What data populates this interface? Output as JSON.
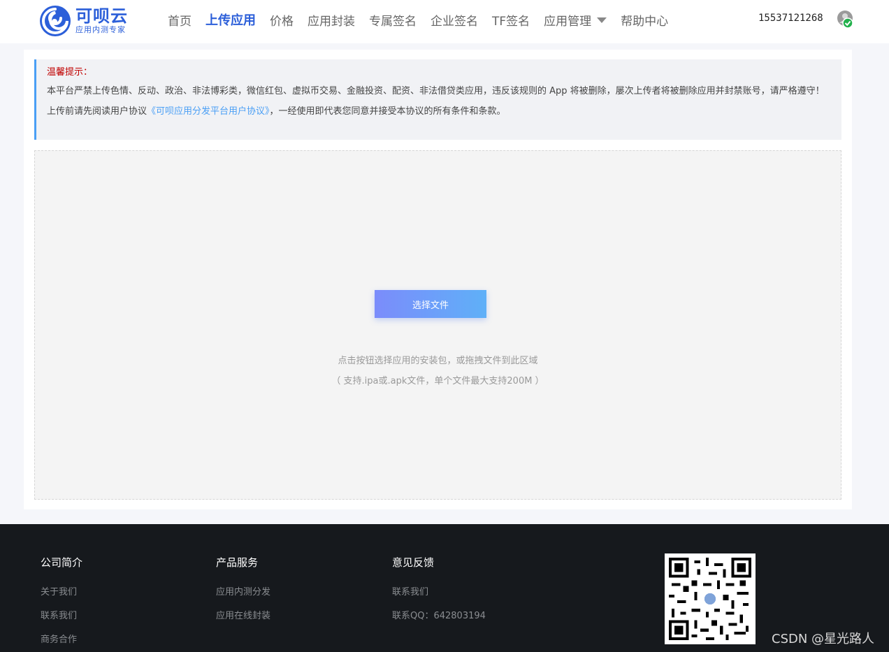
{
  "header": {
    "logo_title": "可呗云",
    "logo_sub": "应用内测专家",
    "nav": [
      {
        "label": "首页",
        "active": false
      },
      {
        "label": "上传应用",
        "active": true
      },
      {
        "label": "价格",
        "active": false
      },
      {
        "label": "应用封装",
        "active": false
      },
      {
        "label": "专属签名",
        "active": false
      },
      {
        "label": "企业签名",
        "active": false
      },
      {
        "label": "TF签名",
        "active": false
      },
      {
        "label": "应用管理",
        "active": false,
        "dropdown": true
      },
      {
        "label": "帮助中心",
        "active": false
      }
    ],
    "phone": "15537121268",
    "user_icon": "user-verified-icon"
  },
  "notice": {
    "title": "温馨提示：",
    "body": "本平台严禁上传色情、反动、政治、非法博彩类，微信红包、虚拟币交易、金融投资、配资、非法借贷类应用，违反该规则的 App 将被删除，屡次上传者将被删除应用并封禁账号，请严格遵守！",
    "agree_prefix": "上传前请先阅读用户协议",
    "agree_link": "《可呗应用分发平台用户协议》",
    "agree_suffix": "，一经使用即代表您同意并接受本协议的所有条件和条款。"
  },
  "upload": {
    "button_label": "选择文件",
    "hint_line1": "点击按钮选择应用的安装包，或拖拽文件到此区域",
    "hint_line2": "（ 支持.ipa或.apk文件，单个文件最大支持200M ）"
  },
  "footer": {
    "columns": [
      {
        "title": "公司简介",
        "links": [
          "关于我们",
          "联系我们",
          "商务合作"
        ]
      },
      {
        "title": "产品服务",
        "links": [
          "应用内测分发",
          "应用在线封装"
        ]
      },
      {
        "title": "意见反馈",
        "links": [
          "联系我们",
          "联系QQ：642803194"
        ]
      }
    ],
    "qr_icon": "qr-code-icon"
  },
  "watermark": "CSDN @星光路人",
  "colors": {
    "brand": "#2c5fd9",
    "notice_border": "#4a9ff5",
    "warning": "#c00000",
    "footer_bg": "#16191d",
    "verified": "#22b14c"
  }
}
